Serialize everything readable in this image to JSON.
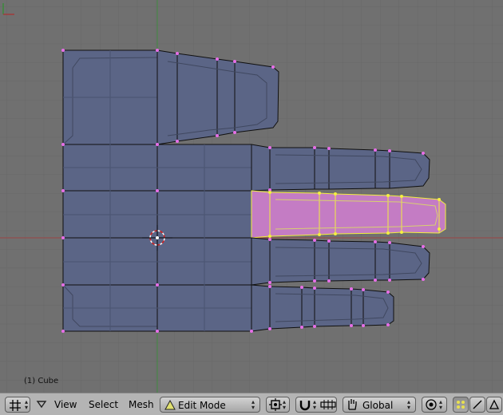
{
  "viewport": {
    "object_label": "(1) Cube",
    "colors": {
      "background": "#707070",
      "grid": "#666666",
      "mesh_fill": "#5a6486",
      "edge": "#111111",
      "vertex": "#e070e0",
      "selected_fill": "#c47cc4",
      "selected_edge": "#f5f040"
    }
  },
  "toolbar": {
    "view_label": "View",
    "select_label": "Select",
    "mesh_label": "Mesh",
    "mode_label": "Edit Mode",
    "orientation_label": "Global",
    "icons": {
      "editor_type": "grid-icon",
      "menu_toggle": "triangle-down-icon",
      "mode": "edit-mode-icon",
      "pivot": "pivot-icon",
      "magnet": "magnet-icon",
      "snap": "snap-icon",
      "hand": "hand-icon",
      "proportional": "proportional-icon",
      "vertex_select": "vertex-select-icon",
      "edge_select": "edge-select-icon",
      "face_select": "face-select-icon"
    }
  }
}
